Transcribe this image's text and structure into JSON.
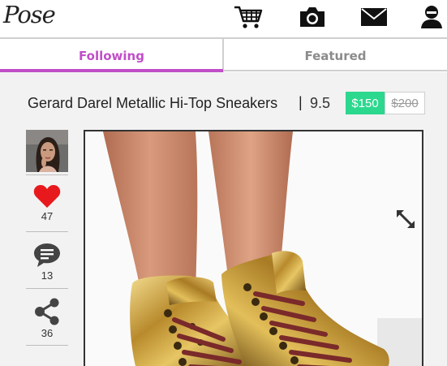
{
  "app": {
    "logo_text": "Pose"
  },
  "header": {
    "icons": [
      "shopping-cart-icon",
      "camera-icon",
      "mail-icon",
      "profile-icon"
    ]
  },
  "tabs": [
    {
      "label": "Following",
      "active": true
    },
    {
      "label": "Featured",
      "active": false
    }
  ],
  "product": {
    "title": "Gerard Darel Metallic Hi-Top Sneakers",
    "separator": "|",
    "size": "9.5",
    "price_sale": "$150",
    "price_original": "$200"
  },
  "actions": {
    "likes": "47",
    "comments": "13",
    "shares": "36"
  },
  "colors": {
    "accent": "#c04ec8",
    "sale": "#2bd88e",
    "heart": "#e8191d"
  }
}
